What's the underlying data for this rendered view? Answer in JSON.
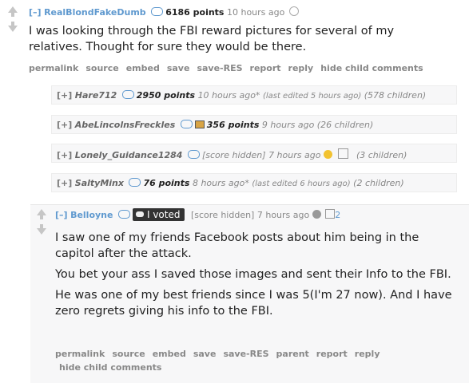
{
  "root": {
    "toggle": "[–]",
    "author": "RealBlondFakeDumb",
    "points": "6186 points",
    "time": "10 hours ago",
    "body": "I was looking through the FBI reward pictures for several of my relatives. Thought for sure they would be there.",
    "buttons": [
      "permalink",
      "source",
      "embed",
      "save",
      "save-RES",
      "report",
      "reply",
      "hide child comments"
    ]
  },
  "collapsed": [
    {
      "toggle": "[+]",
      "author": "Hare712",
      "points": "2950 points",
      "time": "10 hours ago*",
      "extra": "(last edited 5 hours ago)",
      "children": "(578 children)"
    },
    {
      "toggle": "[+]",
      "author": "AbeLincolnsFreckles",
      "points": "356 points",
      "time": "9 hours ago",
      "extra": "",
      "children": "(26 children)"
    },
    {
      "toggle": "[+]",
      "author": "Lonely_Guidance1284",
      "points": "[score hidden]",
      "time": "7 hours ago",
      "extra": "",
      "children": "(3 children)"
    },
    {
      "toggle": "[+]",
      "author": "SaltyMinx",
      "points": "76 points",
      "time": "8 hours ago*",
      "extra": "(last edited 6 hours ago)",
      "children": "(2 children)"
    }
  ],
  "reply": {
    "toggle": "[–]",
    "author": "Belloyne",
    "flair": "I voted",
    "points": "[score hidden]",
    "time": "7 hours ago",
    "award_count": "2",
    "paragraphs": [
      "I saw one of my friends Facebook posts about him being in the capitol after the attack.",
      "You bet your ass I saved those images and sent their Info to the FBI.",
      "He was one of my best friends since I was 5(I'm 27 now). And I have zero regrets giving his info to the FBI."
    ],
    "buttons": [
      "permalink",
      "source",
      "embed",
      "save",
      "save-RES",
      "parent",
      "report",
      "reply"
    ],
    "hide_label": "hide child comments"
  },
  "colors": {
    "link": "#5f99cf",
    "meta": "#888888",
    "panel": "#f7f7f8"
  }
}
